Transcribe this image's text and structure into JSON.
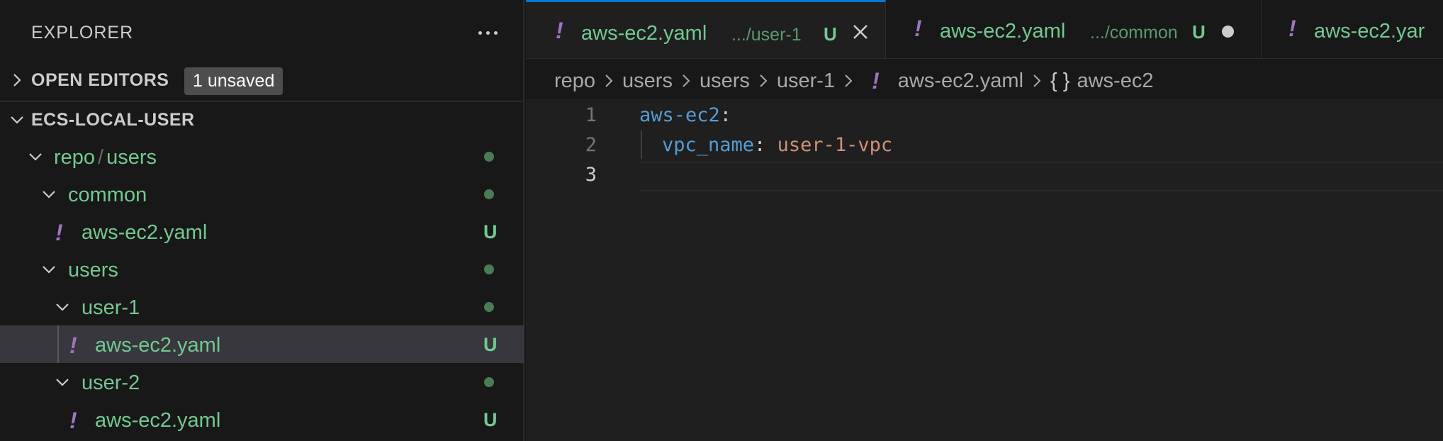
{
  "sidebar": {
    "title": "EXPLORER",
    "more_icon": "ellipsis-icon",
    "open_editors": {
      "label": "OPEN EDITORS",
      "badge": "1 unsaved"
    },
    "workspace": {
      "label": "ECS-LOCAL-USER"
    },
    "tree": [
      {
        "name_a": "repo",
        "sep": "/",
        "name_b": "users"
      },
      {
        "name": "common"
      },
      {
        "name": "aws-ec2.yaml",
        "status": "U"
      },
      {
        "name": "users"
      },
      {
        "name": "user-1"
      },
      {
        "name": "aws-ec2.yaml",
        "status": "U"
      },
      {
        "name": "user-2"
      },
      {
        "name": "aws-ec2.yaml",
        "status": "U"
      }
    ]
  },
  "tabs": [
    {
      "name": "aws-ec2.yaml",
      "desc": ".../user-1",
      "status": "U",
      "active": true
    },
    {
      "name": "aws-ec2.yaml",
      "desc": ".../common",
      "status": "U",
      "active": false
    },
    {
      "name": "aws-ec2.yar",
      "active": false
    }
  ],
  "breadcrumb": {
    "items": [
      "repo",
      "users",
      "users",
      "user-1"
    ],
    "file": "aws-ec2.yaml",
    "symbol_icon": "{ }",
    "symbol": "aws-ec2"
  },
  "editor": {
    "lines": [
      {
        "num": "1",
        "key": "aws-ec2",
        "colon": ":"
      },
      {
        "num": "2",
        "key": "vpc_name",
        "colon": ": ",
        "value": "user-1-vpc"
      },
      {
        "num": "3"
      }
    ]
  },
  "colors": {
    "git_untracked": "#73c991",
    "yaml_icon": "#a074c4",
    "active_tab_border": "#0078d4"
  }
}
